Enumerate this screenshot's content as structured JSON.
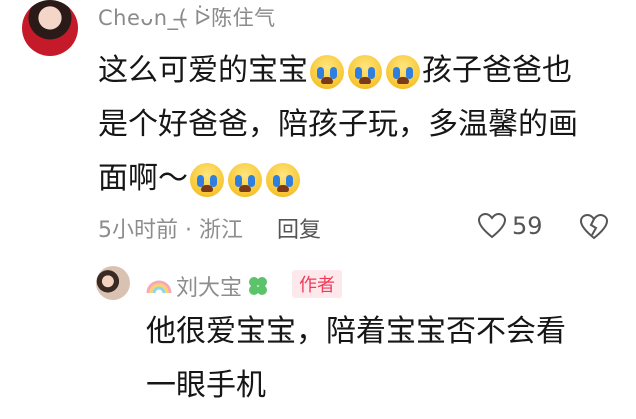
{
  "comment": {
    "username": "Cheᴗn_(̶ ᐖ陈住气",
    "text_line1a": "这么可爱的宝宝",
    "text_line1b": "孩子爸爸也",
    "text_line2": "是个好爸爸，陪孩子玩，多温馨的画",
    "text_line3": "面啊～",
    "emojis": [
      "loudly-crying-emoji",
      "loudly-crying-emoji",
      "loudly-crying-emoji"
    ],
    "time_location": "5小时前 · 浙江",
    "reply_label": "回复",
    "like_count": "59"
  },
  "reply": {
    "username": "刘大宝",
    "author_badge": "作者",
    "text_line1": "他很爱宝宝，陪着宝宝否不会看",
    "text_line2": "一眼手机"
  },
  "colors": {
    "text_primary": "#161616",
    "text_muted": "#8d8d8d",
    "author_badge_text": "#f13b5a",
    "author_badge_bg": "#fde8ec"
  }
}
